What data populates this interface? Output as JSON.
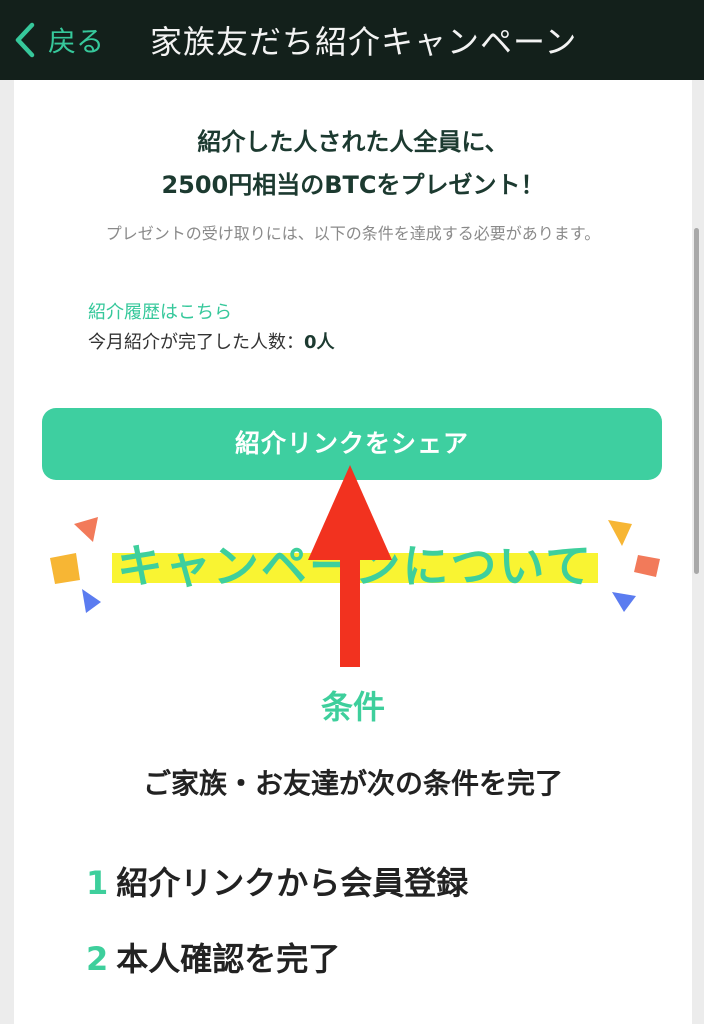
{
  "header": {
    "back_label": "戻る",
    "title": "家族友だち紹介キャンペーン"
  },
  "hero": {
    "line1": "紹介した人された人全員に、",
    "line2": "2500円相当のBTCをプレゼント！",
    "note": "プレゼントの受け取りには、以下の条件を達成する必要があります。"
  },
  "referral": {
    "history_link": "紹介履歴はこちら",
    "count_label": "今月紹介が完了した人数：",
    "count_value": "0人"
  },
  "share_button": "紹介リンクをシェア",
  "campaign": {
    "heading": "キャンペーンについて"
  },
  "conditions": {
    "title": "条件",
    "subtitle": "ご家族・お友達が次の条件を完了",
    "steps": [
      {
        "num": "1",
        "text": "紹介リンクから会員登録"
      },
      {
        "num": "2",
        "text": "本人確認を完了"
      }
    ]
  },
  "colors": {
    "accent": "#3ecf9c",
    "header_bg": "#13201b",
    "highlight": "#f9f432",
    "arrow": "#f2321f"
  },
  "icons": {
    "back": "chevron-left-icon",
    "arrow": "arrow-up-icon"
  }
}
